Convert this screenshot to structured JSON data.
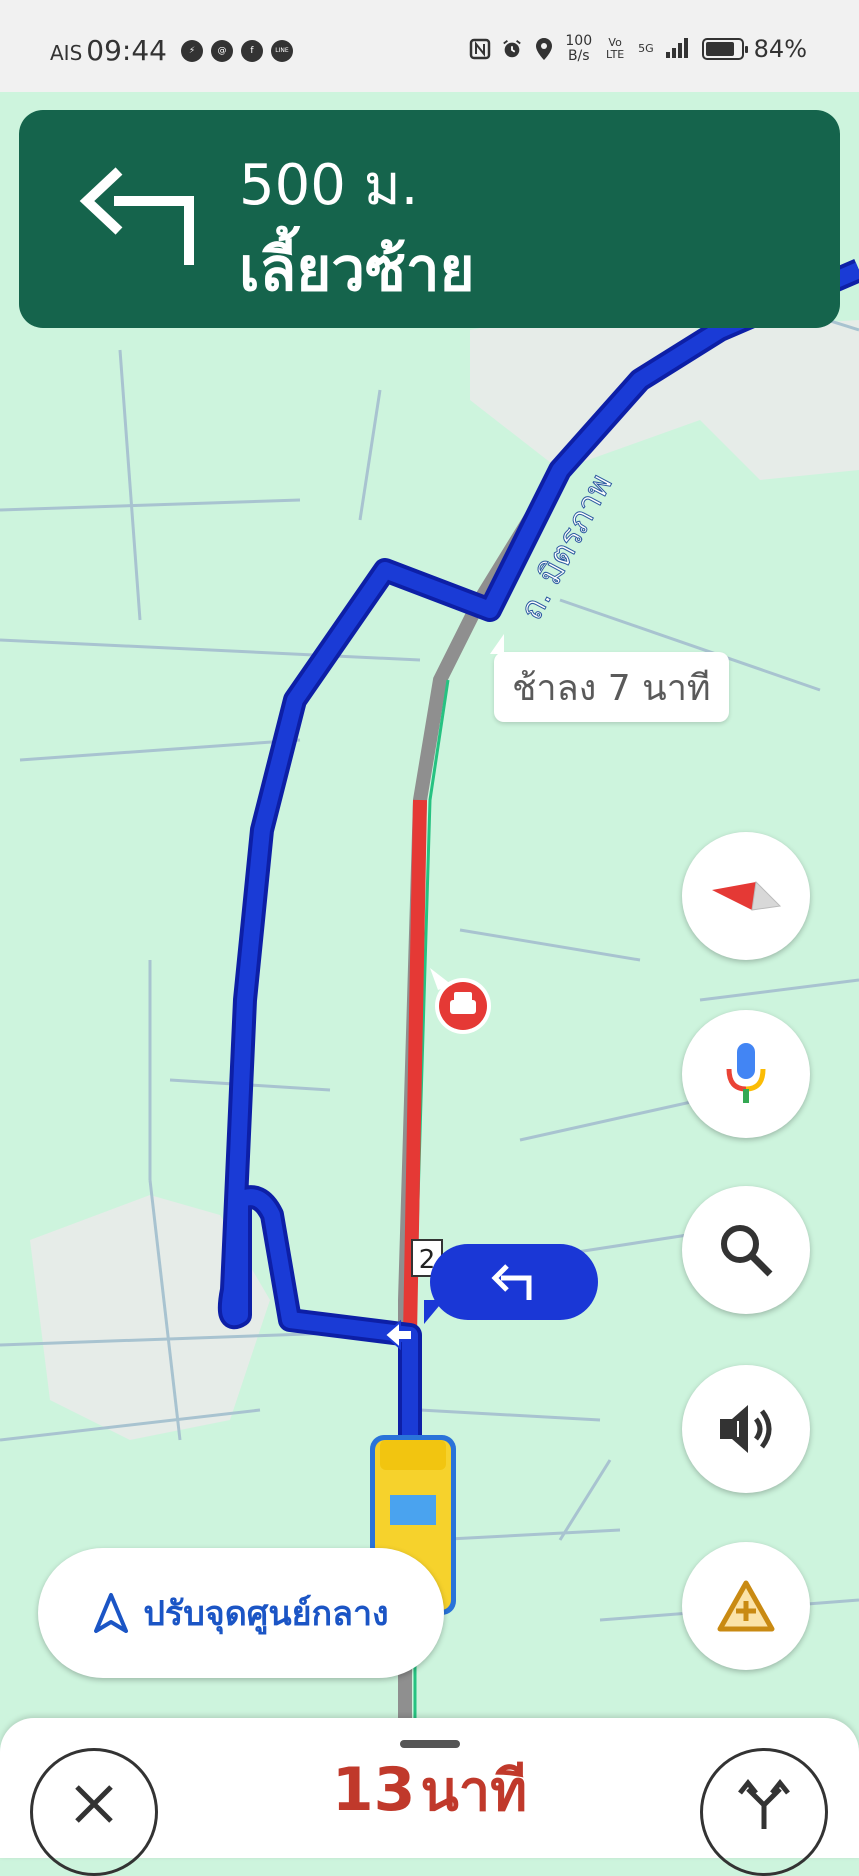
{
  "status_bar": {
    "carrier": "AIS",
    "time": "09:44",
    "app_icons": [
      "messenger-icon",
      "threads-icon",
      "facebook-icon",
      "line-icon"
    ],
    "line_label": "LINE",
    "net_speed_value": "100",
    "net_speed_unit": "B/s",
    "volte_label": "Vo LTE",
    "network_type": "5G",
    "battery_percent": "84%",
    "battery_level": 0.84
  },
  "nav_banner": {
    "distance": "500 ม.",
    "instruction": "เลี้ยวซ้าย",
    "color": "#15644c",
    "icon": "turn-left-arrow-icon"
  },
  "map": {
    "road_label": "ถ. มิตรภาพ",
    "delay_callout": "ช้าลง 7 นาที",
    "route_number": "2",
    "route_color": "#1a3bd6",
    "traffic_color": "#e53935",
    "incident_icon": "traffic-incident-icon"
  },
  "fab_buttons": [
    {
      "name": "compass",
      "icon": "compass-icon"
    },
    {
      "name": "voice",
      "icon": "microphone-icon"
    },
    {
      "name": "search",
      "icon": "search-icon"
    },
    {
      "name": "sound",
      "icon": "speaker-icon"
    },
    {
      "name": "report",
      "icon": "report-incident-icon"
    }
  ],
  "recenter": {
    "label": "ปรับจุดศูนย์กลาง",
    "icon": "navigation-arrow-icon"
  },
  "bottom_sheet": {
    "eta_value": "13",
    "eta_unit": "นาที"
  }
}
